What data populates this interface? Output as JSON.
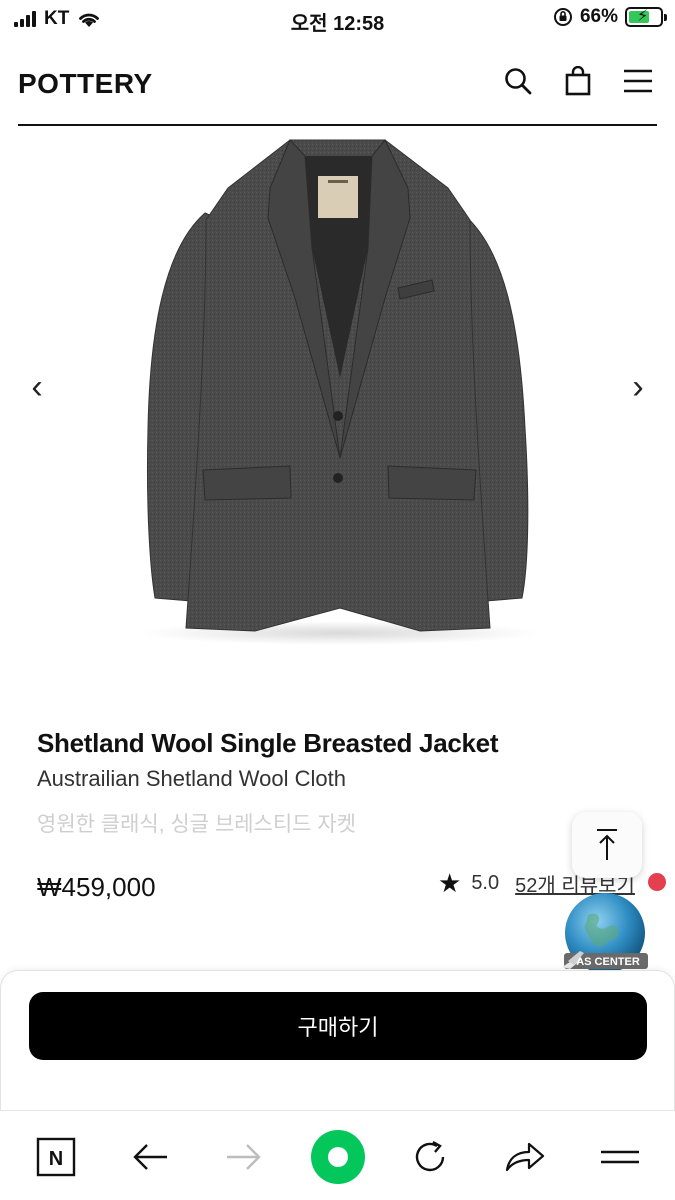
{
  "status_bar": {
    "carrier": "KT",
    "time": "오전 12:58",
    "battery_percent": "66%",
    "battery_level": 0.66
  },
  "header": {
    "logo": "POTTERY",
    "icons": [
      "search-icon",
      "bag-icon",
      "menu-icon"
    ]
  },
  "product": {
    "title": "Shetland Wool Single Breasted Jacket",
    "subtitle": "Austrailian Shetland Wool Cloth",
    "description": "영원한 클래식, 싱글 브레스티드 자켓",
    "price": "₩459,000",
    "rating": "5.0",
    "reviews_link": "52개 리뷰보기",
    "carousel_prev": "‹",
    "carousel_next": "›"
  },
  "badge": {
    "text": "AS CENTER"
  },
  "buy_panel": {
    "button_label": "구매하기"
  },
  "toolbar": {
    "home_label": "N",
    "items": [
      "naver-home-icon",
      "back-arrow-icon",
      "forward-arrow-icon",
      "green-dot-icon",
      "refresh-icon",
      "share-icon",
      "menu-lines-icon"
    ]
  },
  "colors": {
    "accent_green": "#03c75a",
    "battery_green": "#34c759",
    "notification_red": "#e5404f",
    "jacket": "#4a4a4a"
  }
}
